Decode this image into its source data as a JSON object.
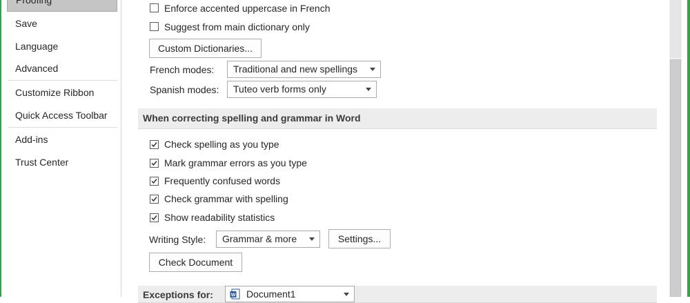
{
  "nav": {
    "selected": "Proofing",
    "items": [
      {
        "label": "Save"
      },
      {
        "label": "Language"
      },
      {
        "label": "Advanced"
      },
      {
        "label": "Customize Ribbon"
      },
      {
        "label": "Quick Access Toolbar"
      },
      {
        "label": "Add-ins"
      },
      {
        "label": "Trust Center"
      }
    ]
  },
  "options_top": {
    "enforce_accented": {
      "label": "Enforce accented uppercase in French",
      "checked": false
    },
    "suggest_main": {
      "label": "Suggest from main dictionary only",
      "checked": false
    },
    "custom_dictionaries_button": "Custom Dictionaries...",
    "french_modes": {
      "label": "French modes:",
      "value": "Traditional and new spellings"
    },
    "spanish_modes": {
      "label": "Spanish modes:",
      "value": "Tuteo verb forms only"
    }
  },
  "word_section": {
    "title": "When correcting spelling and grammar in Word",
    "checks": [
      {
        "label": "Check spelling as you type",
        "checked": true
      },
      {
        "label": "Mark grammar errors as you type",
        "checked": true
      },
      {
        "label": "Frequently confused words",
        "checked": true
      },
      {
        "label": "Check grammar with spelling",
        "checked": true
      },
      {
        "label": "Show readability statistics",
        "checked": true
      }
    ],
    "writing_style": {
      "label": "Writing Style:",
      "value": "Grammar & more"
    },
    "settings_button": "Settings...",
    "check_document_button": "Check Document"
  },
  "exceptions": {
    "label": "Exceptions for:",
    "document": "Document1"
  },
  "colors": {
    "accent": "#3b9e4a"
  }
}
